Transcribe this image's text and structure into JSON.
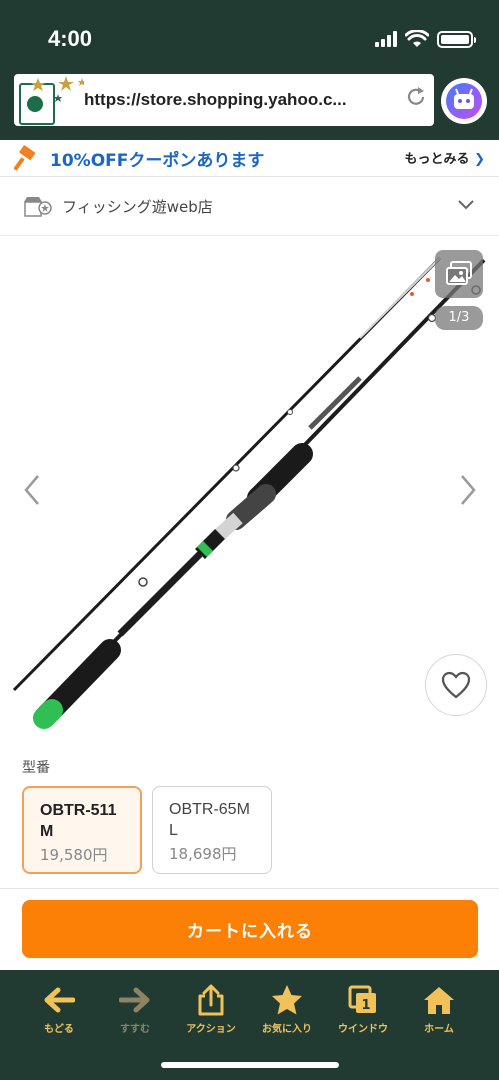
{
  "status": {
    "time": "4:00"
  },
  "browser": {
    "url": "https://store.shopping.yahoo.c...",
    "accent": "#213b32"
  },
  "coupon": {
    "text": "10%OFFクーポンあります",
    "more": "もっとみる",
    "color": "#1c65c9"
  },
  "store": {
    "name": "フィッシング遊web店"
  },
  "gallery": {
    "counter": "1/3"
  },
  "model": {
    "label": "型番",
    "variants": [
      {
        "name": "OBTR-511M",
        "price": "19,580円",
        "selected": true
      },
      {
        "name": "OBTR-65ML",
        "price": "18,698円",
        "selected": false
      }
    ]
  },
  "cart": {
    "label": "カートに入れる",
    "color": "#fb8005"
  },
  "toolbar": {
    "items": [
      {
        "label": "もどる",
        "icon": "arrow-left-icon",
        "enabled": true
      },
      {
        "label": "すすむ",
        "icon": "arrow-right-icon",
        "enabled": false
      },
      {
        "label": "アクション",
        "icon": "share-icon",
        "enabled": true
      },
      {
        "label": "お気に入り",
        "icon": "star-icon",
        "enabled": true
      },
      {
        "label": "ウインドウ",
        "icon": "windows-icon",
        "enabled": true
      },
      {
        "label": "ホーム",
        "icon": "home-icon",
        "enabled": true
      }
    ],
    "color": "#f1c15a"
  }
}
